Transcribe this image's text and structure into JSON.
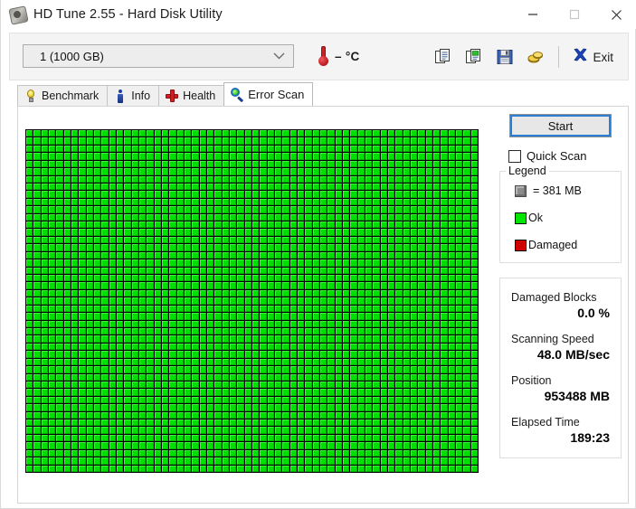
{
  "window": {
    "title": "HD Tune 2.55 - Hard Disk Utility",
    "icon": "hard-disk-icon",
    "controls": {
      "minimize": "minimize-icon",
      "maximize": "maximize-icon",
      "close": "close-icon"
    }
  },
  "toolbar": {
    "drive_selected": "1 (1000 GB)",
    "drive_options": [
      "1 (1000 GB)"
    ],
    "temperature": "– °C",
    "thermometer_color": "#c8242a",
    "icons": [
      {
        "name": "copy-icon",
        "label": "Copy"
      },
      {
        "name": "copy-image-icon",
        "label": "Copy with image"
      },
      {
        "name": "save-icon",
        "label": "Save"
      },
      {
        "name": "gold-icon",
        "label": "Options"
      }
    ],
    "exit_label": "Exit",
    "exit_accel": "x"
  },
  "tabs": [
    {
      "label": "Benchmark",
      "icon": "lightbulb-icon",
      "active": false
    },
    {
      "label": "Info",
      "icon": "info-icon",
      "active": false
    },
    {
      "label": "Health",
      "icon": "red-cross-icon",
      "active": false
    },
    {
      "label": "Error Scan",
      "icon": "magnifier-icon",
      "active": true
    }
  ],
  "scan": {
    "start_label": "Start",
    "quick_scan_label": "Quick Scan",
    "quick_scan_checked": false,
    "grid": {
      "columns": 60,
      "rows": 45,
      "ok_color": "#00e000",
      "damaged_color": "#cc0000",
      "background_color": "#000000",
      "damaged_cells": []
    }
  },
  "legend": {
    "title": "Legend",
    "block_size": "= 381 MB",
    "ok_label": "Ok",
    "damaged_label": "Damaged",
    "ok_color": "#00e400",
    "damaged_color": "#d00000",
    "block_color": "#8c8c8c"
  },
  "stats": [
    {
      "label": "Damaged Blocks",
      "value": "0.0 %"
    },
    {
      "label": "Scanning Speed",
      "value": "48.0 MB/sec"
    },
    {
      "label": "Position",
      "value": "953488 MB"
    },
    {
      "label": "Elapsed Time",
      "value": "189:23"
    }
  ]
}
